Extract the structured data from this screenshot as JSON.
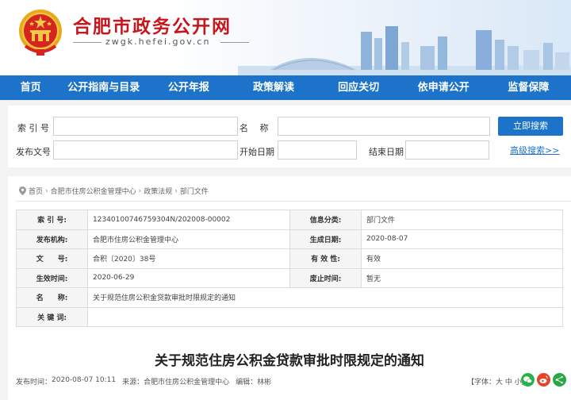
{
  "header": {
    "site_title": "合肥市政务公开网",
    "site_url": "zwgk.hefei.gov.cn"
  },
  "nav": {
    "items": [
      "首页",
      "公开指南与目录",
      "公开年报",
      "政策解读",
      "回应关切",
      "依申请公开",
      "监督保障"
    ]
  },
  "search": {
    "index_label": "索 引 号",
    "name_label": "名　 称",
    "doc_no_label": "发布文号",
    "start_date_label": "开始日期",
    "end_date_label": "结束日期",
    "search_button": "立即搜索",
    "advanced_link": "高级搜索>>"
  },
  "breadcrumb": {
    "items": [
      "首页",
      "合肥市住房公积金管理中心",
      "政策法规",
      "部门文件"
    ]
  },
  "info": {
    "index_label": "索 引 号:",
    "index_value": "12340100746759304N/202008-00002",
    "category_label": "信息分类:",
    "category_value": "部门文件",
    "publisher_label": "发布机构:",
    "publisher_value": "合肥市住房公积金管理中心",
    "gen_date_label": "生成日期:",
    "gen_date_value": "2020-08-07",
    "docno_label": "文　　号:",
    "docno_value": "合积〔2020〕38号",
    "validity_label": "有 效 性:",
    "validity_value": "有效",
    "effect_label": "生效时间:",
    "effect_value": "2020-06-29",
    "abolish_label": "废止时间:",
    "abolish_value": "暂无",
    "name_label": "名　　称:",
    "name_value": "关于规范住房公积金贷款审批时限规定的通知",
    "keywords_label": "关 键 词:",
    "keywords_value": ""
  },
  "article": {
    "title": "关于规范住房公积金贷款审批时限规定的通知",
    "publish_time_label": "发布时间：",
    "publish_time_value": "2020-08-07 10:11",
    "source_label": "来源：",
    "source_value": "合肥市住房公积金管理中心",
    "editor_label": "编辑：",
    "editor_value": "林彬",
    "font_size_text": "【字体：大 中 小】"
  },
  "colors": {
    "nav_blue": "#1c73c9",
    "title_red": "#c8161d",
    "wechat_green": "#28b34a",
    "weibo_red": "#e6442a"
  },
  "icons": [
    "national-emblem-icon",
    "location-icon",
    "wechat-icon",
    "weibo-icon",
    "share-icon"
  ]
}
